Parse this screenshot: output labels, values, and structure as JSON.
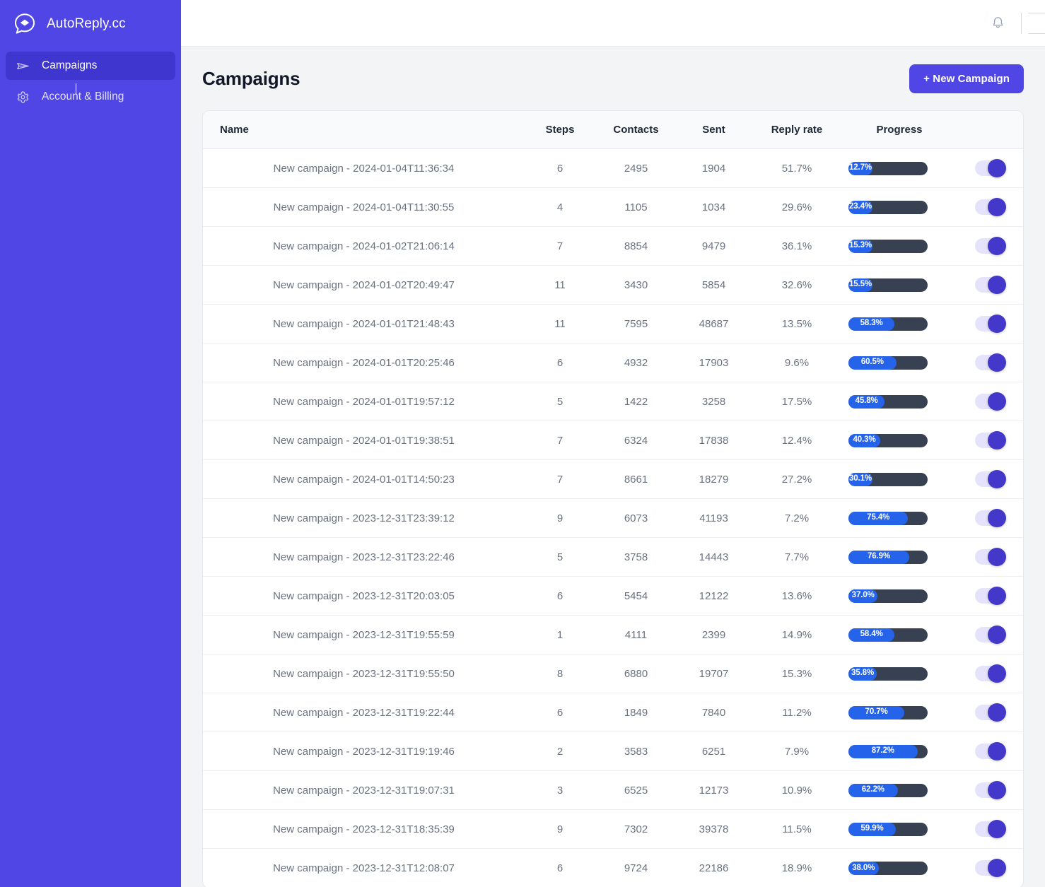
{
  "brand": {
    "name": "AutoReply.cc",
    "logo_icon": "speech-bubble-diamond-icon"
  },
  "sidebar": {
    "items": [
      {
        "label": "Campaigns",
        "icon": "send-paper-plane-icon",
        "active": true
      },
      {
        "label": "Account & Billing",
        "icon": "gear-icon",
        "active": false
      }
    ]
  },
  "topbar": {
    "notification_icon": "bell-icon",
    "avatar_placeholder": "avatar-placeholder"
  },
  "page": {
    "title": "Campaigns",
    "new_campaign_label": "+ New Campaign"
  },
  "table": {
    "columns": [
      "Name",
      "Steps",
      "Contacts",
      "Sent",
      "Reply rate",
      "Progress"
    ],
    "rows": [
      {
        "name": "New campaign - 2024-01-04T11:36:34",
        "steps": "6",
        "contacts": "2495",
        "sent": "1904",
        "reply_rate": "51.7%",
        "progress": "12.7%",
        "progress_value": 12.7,
        "enabled": true
      },
      {
        "name": "New campaign - 2024-01-04T11:30:55",
        "steps": "4",
        "contacts": "1105",
        "sent": "1034",
        "reply_rate": "29.6%",
        "progress": "23.4%",
        "progress_value": 23.4,
        "enabled": true
      },
      {
        "name": "New campaign - 2024-01-02T21:06:14",
        "steps": "7",
        "contacts": "8854",
        "sent": "9479",
        "reply_rate": "36.1%",
        "progress": "15.3%",
        "progress_value": 15.3,
        "enabled": true
      },
      {
        "name": "New campaign - 2024-01-02T20:49:47",
        "steps": "11",
        "contacts": "3430",
        "sent": "5854",
        "reply_rate": "32.6%",
        "progress": "15.5%",
        "progress_value": 15.5,
        "enabled": true
      },
      {
        "name": "New campaign - 2024-01-01T21:48:43",
        "steps": "11",
        "contacts": "7595",
        "sent": "48687",
        "reply_rate": "13.5%",
        "progress": "58.3%",
        "progress_value": 58.3,
        "enabled": true
      },
      {
        "name": "New campaign - 2024-01-01T20:25:46",
        "steps": "6",
        "contacts": "4932",
        "sent": "17903",
        "reply_rate": "9.6%",
        "progress": "60.5%",
        "progress_value": 60.5,
        "enabled": true
      },
      {
        "name": "New campaign - 2024-01-01T19:57:12",
        "steps": "5",
        "contacts": "1422",
        "sent": "3258",
        "reply_rate": "17.5%",
        "progress": "45.8%",
        "progress_value": 45.8,
        "enabled": true
      },
      {
        "name": "New campaign - 2024-01-01T19:38:51",
        "steps": "7",
        "contacts": "6324",
        "sent": "17838",
        "reply_rate": "12.4%",
        "progress": "40.3%",
        "progress_value": 40.3,
        "enabled": true
      },
      {
        "name": "New campaign - 2024-01-01T14:50:23",
        "steps": "7",
        "contacts": "8661",
        "sent": "18279",
        "reply_rate": "27.2%",
        "progress": "30.1%",
        "progress_value": 30.1,
        "enabled": true
      },
      {
        "name": "New campaign - 2023-12-31T23:39:12",
        "steps": "9",
        "contacts": "6073",
        "sent": "41193",
        "reply_rate": "7.2%",
        "progress": "75.4%",
        "progress_value": 75.4,
        "enabled": true
      },
      {
        "name": "New campaign - 2023-12-31T23:22:46",
        "steps": "5",
        "contacts": "3758",
        "sent": "14443",
        "reply_rate": "7.7%",
        "progress": "76.9%",
        "progress_value": 76.9,
        "enabled": true
      },
      {
        "name": "New campaign - 2023-12-31T20:03:05",
        "steps": "6",
        "contacts": "5454",
        "sent": "12122",
        "reply_rate": "13.6%",
        "progress": "37.0%",
        "progress_value": 37.0,
        "enabled": true
      },
      {
        "name": "New campaign - 2023-12-31T19:55:59",
        "steps": "1",
        "contacts": "4111",
        "sent": "2399",
        "reply_rate": "14.9%",
        "progress": "58.4%",
        "progress_value": 58.4,
        "enabled": true
      },
      {
        "name": "New campaign - 2023-12-31T19:55:50",
        "steps": "8",
        "contacts": "6880",
        "sent": "19707",
        "reply_rate": "15.3%",
        "progress": "35.8%",
        "progress_value": 35.8,
        "enabled": true
      },
      {
        "name": "New campaign - 2023-12-31T19:22:44",
        "steps": "6",
        "contacts": "1849",
        "sent": "7840",
        "reply_rate": "11.2%",
        "progress": "70.7%",
        "progress_value": 70.7,
        "enabled": true
      },
      {
        "name": "New campaign - 2023-12-31T19:19:46",
        "steps": "2",
        "contacts": "3583",
        "sent": "6251",
        "reply_rate": "7.9%",
        "progress": "87.2%",
        "progress_value": 87.2,
        "enabled": true
      },
      {
        "name": "New campaign - 2023-12-31T19:07:31",
        "steps": "3",
        "contacts": "6525",
        "sent": "12173",
        "reply_rate": "10.9%",
        "progress": "62.2%",
        "progress_value": 62.2,
        "enabled": true
      },
      {
        "name": "New campaign - 2023-12-31T18:35:39",
        "steps": "9",
        "contacts": "7302",
        "sent": "39378",
        "reply_rate": "11.5%",
        "progress": "59.9%",
        "progress_value": 59.9,
        "enabled": true
      },
      {
        "name": "New campaign - 2023-12-31T12:08:07",
        "steps": "6",
        "contacts": "9724",
        "sent": "22186",
        "reply_rate": "18.9%",
        "progress": "38.0%",
        "progress_value": 38.0,
        "enabled": true
      }
    ]
  },
  "colors": {
    "sidebar_bg": "#4f46e5",
    "sidebar_active_bg": "#3f35cf",
    "accent": "#4f46e5",
    "progress_track": "#374151",
    "progress_fill": "#2563eb",
    "toggle_knob": "#4338ca",
    "page_bg": "#f3f4f6"
  }
}
